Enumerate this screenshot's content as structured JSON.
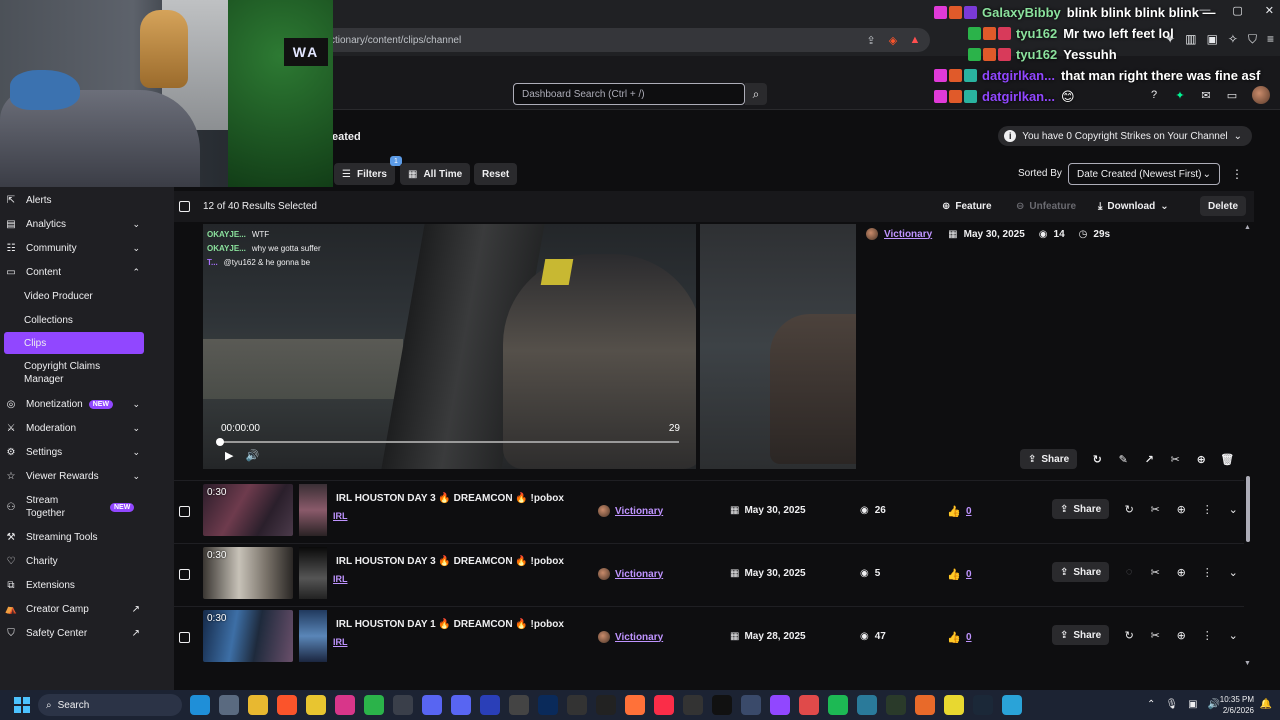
{
  "browser": {
    "url": "ctionary/content/clips/channel"
  },
  "header": {
    "search_placeholder": "Dashboard Search (Ctrl + /)"
  },
  "page": {
    "title_fragment": "eated",
    "strikes_text": "You have 0 Copyright Strikes on Your Channel"
  },
  "filters": {
    "filters_label": "Filters",
    "filters_count": "1",
    "time_label": "All Time",
    "reset_label": "Reset",
    "sorted_by_label": "Sorted By",
    "sort_value": "Date Created (Newest First)"
  },
  "selection": {
    "summary": "12 of 40 Results Selected",
    "feature_label": "Feature",
    "unfeature_label": "Unfeature",
    "download_label": "Download",
    "delete_label": "Delete"
  },
  "featured_clip": {
    "channel": "Victionary",
    "date": "May 30, 2025",
    "views": "14",
    "duration": "29s",
    "share_label": "Share",
    "player_time": "00:00:00",
    "player_end": "29",
    "chat": [
      {
        "user": "OKAYJE...",
        "msg": "WTF"
      },
      {
        "user": "OKAYJE...",
        "msg": "why we gotta suffer"
      },
      {
        "user": "T...",
        "msg": "@tyu162 & he gonna be"
      }
    ]
  },
  "clips": [
    {
      "duration": "0:30",
      "title": "IRL HOUSTON DAY 3 🔥 DREAMCON 🔥 !pobox",
      "category": "IRL",
      "channel": "Victionary",
      "date": "May 30, 2025",
      "views": "26",
      "likes": "0",
      "share_label": "Share"
    },
    {
      "duration": "0:30",
      "title": "IRL HOUSTON DAY 3 🔥 DREAMCON 🔥 !pobox",
      "category": "IRL",
      "channel": "Victionary",
      "date": "May 30, 2025",
      "views": "5",
      "likes": "0",
      "share_label": "Share"
    },
    {
      "duration": "0:30",
      "title": "IRL HOUSTON DAY 1 🔥 DREAMCON 🔥 !pobox",
      "category": "IRL",
      "channel": "Victionary",
      "date": "May 28, 2025",
      "views": "47",
      "likes": "0",
      "share_label": "Share"
    }
  ],
  "sidebar": {
    "items": [
      {
        "label": "Alerts",
        "icon": "alert-icon"
      },
      {
        "label": "Analytics",
        "icon": "analytics-icon"
      },
      {
        "label": "Community",
        "icon": "community-icon"
      },
      {
        "label": "Content",
        "icon": "content-icon"
      },
      {
        "label": "Video Producer"
      },
      {
        "label": "Collections"
      },
      {
        "label": "Clips"
      },
      {
        "label": "Copyright Claims Manager"
      },
      {
        "label": "Monetization",
        "icon": "monetization-icon",
        "badge": "NEW"
      },
      {
        "label": "Moderation",
        "icon": "moderation-icon"
      },
      {
        "label": "Settings",
        "icon": "settings-icon"
      },
      {
        "label": "Viewer Rewards",
        "icon": "rewards-icon"
      },
      {
        "label": "Stream Together",
        "icon": "stream-together-icon",
        "badge": "NEW"
      },
      {
        "label": "Streaming Tools",
        "icon": "tools-icon"
      },
      {
        "label": "Charity",
        "icon": "charity-icon"
      },
      {
        "label": "Extensions",
        "icon": "extensions-icon"
      },
      {
        "label": "Creator Camp",
        "icon": "camp-icon"
      },
      {
        "label": "Safety Center",
        "icon": "safety-icon"
      }
    ]
  },
  "webcam": {
    "neon_text": "WA"
  },
  "stream_chat": [
    {
      "user": "GalaxyBibby",
      "msg": "blink blink blink blink —",
      "color": "#8be29d"
    },
    {
      "user": "tyu162",
      "msg": "Mr two left feet lol",
      "color": "#8be29d"
    },
    {
      "user": "tyu162",
      "msg": "Yessuhh",
      "color": "#8be29d"
    },
    {
      "user": "datgirlkan...",
      "msg": "that man right there was fine asf",
      "color": "#9147ff"
    },
    {
      "user": "datgirlkan...",
      "msg": "😊",
      "color": "#9147ff"
    }
  ],
  "taskbar": {
    "search_label": "Search",
    "time": "10:35 PM",
    "date": "2/6/2026"
  },
  "colors": {
    "accent": "#9147ff",
    "link": "#bf94ff",
    "background": "#0e0e10",
    "sidebar": "#1f1f23"
  }
}
